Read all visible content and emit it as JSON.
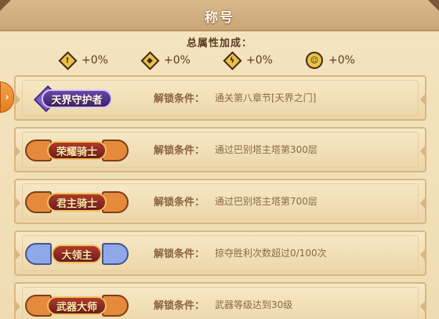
{
  "header": {
    "title": "称号"
  },
  "stats": {
    "title": "总属性加成：",
    "items": [
      {
        "icon": "attack-diamond-icon",
        "value": "+0%"
      },
      {
        "icon": "defense-diamond-icon",
        "value": "+0%"
      },
      {
        "icon": "lightning-diamond-icon",
        "value": "+0%"
      },
      {
        "icon": "health-round-icon",
        "value": "+0%"
      }
    ]
  },
  "titles": [
    {
      "badge": "天界守护者",
      "label": "解锁条件：",
      "condition": "通关第八章节[天界之门]"
    },
    {
      "badge": "荣耀骑士",
      "label": "解锁条件：",
      "condition": "通过巴别塔主塔第300层"
    },
    {
      "badge": "君主骑士",
      "label": "解锁条件：",
      "condition": "通过巴别塔主塔第700层"
    },
    {
      "badge": "大领主",
      "label": "解锁条件：",
      "condition": "掠夺胜利次数超过0/100次"
    },
    {
      "badge": "武器大师",
      "label": "解锁条件：",
      "condition": "武器等级达到30级"
    }
  ],
  "side_tab": {
    "glyph": "›"
  },
  "colors": {
    "accent": "#e77d20",
    "panel": "#f1dfb8",
    "text": "#8a6a48"
  }
}
